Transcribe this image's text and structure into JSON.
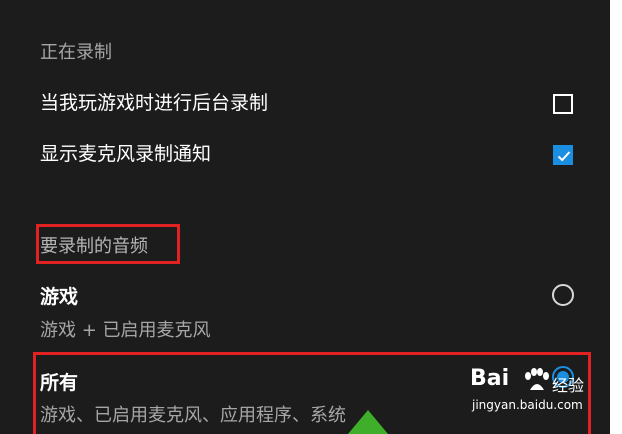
{
  "recording": {
    "section_title": "正在录制",
    "background_record": {
      "label": "当我玩游戏时进行后台录制",
      "checked": false
    },
    "mic_notification": {
      "label": "显示麦克风录制通知",
      "checked": true
    }
  },
  "audio": {
    "section_title": "要录制的音频",
    "options": [
      {
        "title": "游戏",
        "subtitle": "游戏 + 已启用麦克风",
        "selected": false
      },
      {
        "title": "所有",
        "subtitle": "游戏、已启用麦克风、应用程序、系统",
        "selected": true
      }
    ]
  },
  "watermark": {
    "brand": "Bai",
    "brand_suffix": "经验",
    "url": "jingyan.baidu.com"
  },
  "colors": {
    "background": "#1c1c1c",
    "accent": "#1a8ee0",
    "highlight_box": "#e22222",
    "header_text": "#a6a6a6"
  }
}
